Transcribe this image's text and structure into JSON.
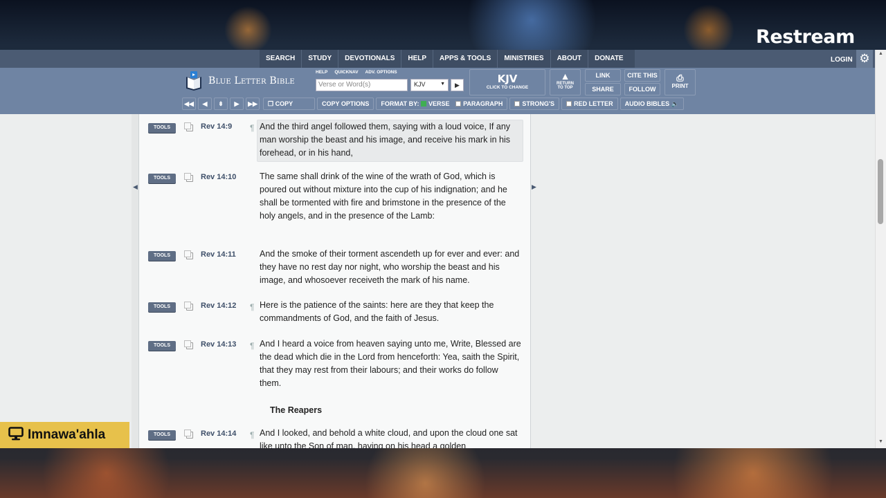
{
  "overlay": {
    "brand": "Restream",
    "badge_name": "Imnawa'ahla",
    "badge_icon": "monitor-icon"
  },
  "nav": {
    "items": [
      "SEARCH",
      "STUDY",
      "DEVOTIONALS",
      "HELP",
      "APPS & TOOLS",
      "MINISTRIES",
      "ABOUT",
      "DONATE"
    ],
    "login": "LOGIN",
    "settings_icon": "gear-icon"
  },
  "header": {
    "logo_text": "Blue Letter Bible",
    "small_links": [
      "HELP",
      "QUICKNAV",
      "ADV. OPTIONS"
    ],
    "search_placeholder": "Verse or Word(s)",
    "version_selected": "KJV",
    "version_big": "KJV",
    "version_sub": "CLICK TO CHANGE",
    "return_to_top": [
      "RETURN",
      "TO TOP"
    ],
    "link": "LINK",
    "share": "SHARE",
    "cite": "CITE THIS",
    "follow": "FOLLOW",
    "print": "PRINT"
  },
  "toolbar": {
    "copy": "COPY",
    "copy_options": "COPY OPTIONS",
    "format_by": "FORMAT BY:",
    "verse": "VERSE",
    "paragraph": "PARAGRAPH",
    "strongs": "STRONG'S",
    "red_letter": "RED LETTER",
    "audio_bibles": "AUDIO BIBLES",
    "accent_check": "#3fae53"
  },
  "verses": [
    {
      "tools": "TOOLS",
      "ref": "Rev 14:9",
      "pilcrow": "¶",
      "text": "And the third angel followed them, saying with a loud voice, If any man worship the beast and his image, and receive his mark in his forehead, or in his hand,"
    },
    {
      "tools": "TOOLS",
      "ref": "Rev 14:10",
      "pilcrow": "",
      "text": "The same shall drink of the wine of the wrath of God, which is poured out without mixture into the cup of his indignation; and he shall be tormented with fire and brimstone in the presence of the holy angels, and in the presence of the Lamb:"
    },
    {
      "tools": "TOOLS",
      "ref": "Rev 14:11",
      "pilcrow": "",
      "text": "And the smoke of their torment ascendeth up for ever and ever: and they have no rest day nor night, who worship the beast and his image, and whosoever receiveth the mark of his name."
    },
    {
      "tools": "TOOLS",
      "ref": "Rev 14:12",
      "pilcrow": "¶",
      "text": "Here is the patience of the saints: here are they that keep the commandments of God, and the faith of Jesus."
    },
    {
      "tools": "TOOLS",
      "ref": "Rev 14:13",
      "pilcrow": "¶",
      "text": "And I heard a voice from heaven saying unto me, Write, Blessed are the dead which die in the Lord from henceforth: Yea, saith the Spirit, that they may rest from their labours; and their works do follow them."
    },
    {
      "tools": "TOOLS",
      "ref": "Rev 14:14",
      "pilcrow": "¶",
      "text": "And I looked, and behold a white cloud, and upon the cloud one sat like unto the Son of man, having on his head a golden"
    }
  ],
  "section_heading": "The Reapers"
}
